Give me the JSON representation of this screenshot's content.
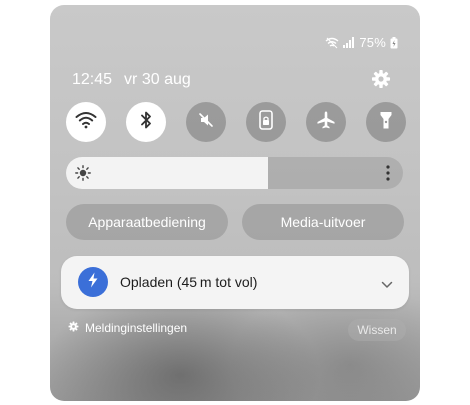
{
  "status_bar": {
    "battery_percent": "75%",
    "wifi_icon": "wifi-calling-icon",
    "signal_icon": "signal-bars-icon",
    "battery_icon": "battery-charging-icon"
  },
  "header": {
    "time": "12:45",
    "date": "vr 30 aug",
    "settings_icon": "gear-icon"
  },
  "quick_toggles": [
    {
      "name": "Wi-Fi",
      "icon": "wifi-icon",
      "active": true
    },
    {
      "name": "Bluetooth",
      "icon": "bluetooth-icon",
      "active": true
    },
    {
      "name": "Mute",
      "icon": "mute-icon",
      "active": false
    },
    {
      "name": "Screen lock",
      "icon": "lock-icon",
      "active": false
    },
    {
      "name": "Airplane mode",
      "icon": "airplane-icon",
      "active": false
    },
    {
      "name": "Flashlight",
      "icon": "flashlight-icon",
      "active": false
    }
  ],
  "brightness": {
    "level": 0.6,
    "icon": "sun-icon"
  },
  "buttons": {
    "device_control": "Apparaatbediening",
    "media_output": "Media-uitvoer"
  },
  "notification": {
    "title": "Opladen (45 m tot vol)",
    "icon": "lightning-bolt-icon",
    "accent": "#3b6fd8"
  },
  "footer": {
    "settings_label": "Meldinginstellingen",
    "clear_label": "Wissen"
  }
}
